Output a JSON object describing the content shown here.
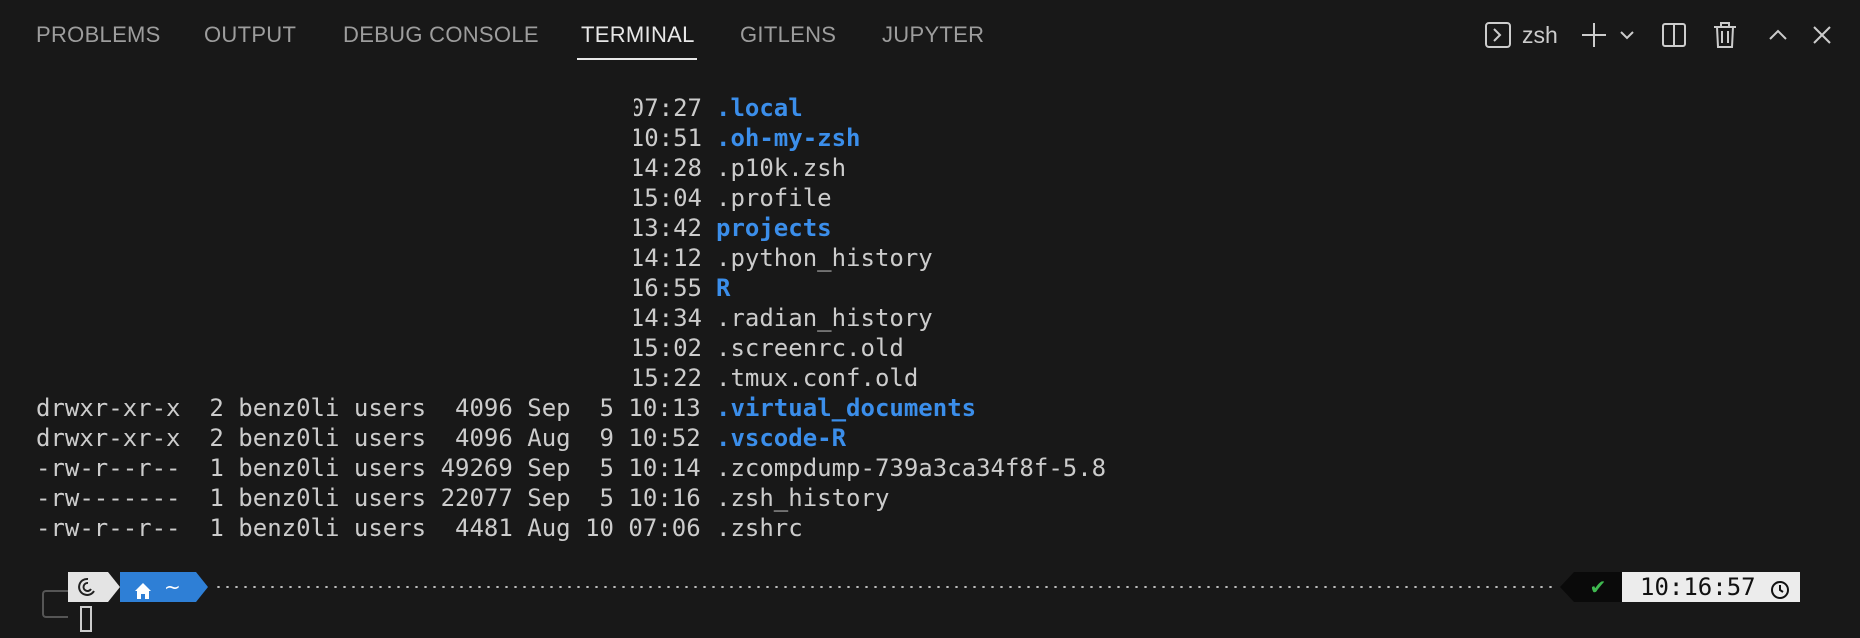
{
  "tabs": [
    {
      "label": "PROBLEMS"
    },
    {
      "label": "OUTPUT"
    },
    {
      "label": "DEBUG CONSOLE"
    },
    {
      "label": "TERMINAL",
      "active": true
    },
    {
      "label": "GITLENS"
    },
    {
      "label": "JUPYTER"
    }
  ],
  "actions": {
    "shell_name": "zsh",
    "icons": [
      "terminal-icon",
      "plus-icon",
      "chevron-down-icon",
      "split-icon",
      "trash-icon",
      "chevron-up-icon",
      "close-icon"
    ]
  },
  "terminal": {
    "partial_lines": [
      {
        "time": "07:27",
        "name": ".local",
        "dir": true
      },
      {
        "time": "10:51",
        "name": ".oh-my-zsh",
        "dir": true
      },
      {
        "time": "14:28",
        "name": ".p10k.zsh",
        "dir": false
      },
      {
        "time": "15:04",
        "name": ".profile",
        "dir": false
      },
      {
        "time": "13:42",
        "name": "projects",
        "dir": true
      },
      {
        "time": "14:12",
        "name": ".python_history",
        "dir": false
      },
      {
        "time": "16:55",
        "name": "R",
        "dir": true
      },
      {
        "time": "14:34",
        "name": ".radian_history",
        "dir": false
      },
      {
        "time": "15:02",
        "name": ".screenrc.old",
        "dir": false
      },
      {
        "time": "15:22",
        "name": ".tmux.conf.old",
        "dir": false
      }
    ],
    "full_lines": [
      {
        "meta": "drwxr-xr-x  2 benz0li users  4096 Sep  5 10:13 ",
        "name": ".virtual_documents",
        "dir": true
      },
      {
        "meta": "drwxr-xr-x  2 benz0li users  4096 Aug  9 10:52 ",
        "name": ".vscode-R",
        "dir": true
      },
      {
        "meta": "-rw-r--r--  1 benz0li users 49269 Sep  5 10:14 ",
        "name": ".zcompdump-739a3ca34f8f-5.8",
        "dir": false
      },
      {
        "meta": "-rw-------  1 benz0li users 22077 Sep  5 10:16 ",
        "name": ".zsh_history",
        "dir": false
      },
      {
        "meta": "-rw-r--r--  1 benz0li users  4481 Aug 10 07:06 ",
        "name": ".zshrc",
        "dir": false
      }
    ]
  },
  "prompt": {
    "os_icon": "debian-swirl-icon",
    "home_icon": "home-icon",
    "dir": "~",
    "status": "✔",
    "time": "10:16:57",
    "clock_icon": "clock-icon"
  }
}
